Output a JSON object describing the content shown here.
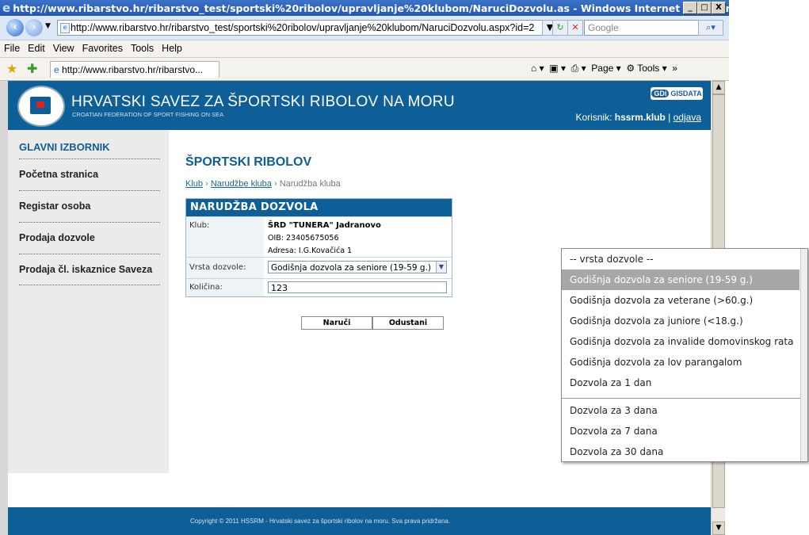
{
  "window": {
    "title": "http://www.ribarstvo.hr/ribarstvo_test/sportski%20ribolov/upravljanje%20klubom/NaruciDozvolu.as - Windows Internet Explorer",
    "controls": [
      "_",
      "□",
      "X"
    ]
  },
  "addressbar": {
    "url": "http://www.ribarstvo.hr/ribarstvo_test/sportski%20ribolov/upravljanje%20klubom/NaruciDozvolu.aspx?id=2",
    "search_placeholder": "Google"
  },
  "menu": [
    "File",
    "Edit",
    "View",
    "Favorites",
    "Tools",
    "Help"
  ],
  "favbar": {
    "tab": "http://www.ribarstvo.hr/ribarstvo...",
    "tools": [
      "Page",
      "Tools"
    ]
  },
  "header": {
    "title": "HRVATSKI SAVEZ ZA ŠPORTSKI RIBOLOV NA MORU",
    "subtitle": "CROATIAN FEDERATION OF SPORT FISHING ON SEA",
    "partner_logo_a": "GDi",
    "partner_logo_b": "GISDATA",
    "user_label": "Korisnik:",
    "user_name": "hssrm.klub",
    "logout": "odjava"
  },
  "sidebar": {
    "title": "GLAVNI IZBORNIK",
    "items": [
      {
        "label": "Početna stranica"
      },
      {
        "label": "Registar osoba"
      },
      {
        "label": "Prodaja dozvole"
      },
      {
        "label": "Prodaja čl. iskaznice Saveza"
      }
    ]
  },
  "main": {
    "title": "ŠPORTSKI RIBOLOV",
    "breadcrumb": [
      "Klub",
      "Narudžbe kluba",
      "Narudžba kluba"
    ],
    "breadcrumb_sep": "›"
  },
  "form": {
    "heading": "NARUDŽBA DOZVOLA",
    "klub_label": "Klub:",
    "klub_name": "ŠRD \"TUNERA\" Jadranovo",
    "oib": "OIB: 23405675056",
    "adresa": "Adresa: I.G.Kovačića 1",
    "vrsta_label": "Vrsta dozvole:",
    "vrsta_value": "Godišnja dozvola za seniore (19-59 g.)",
    "kolicina_label": "Količina:",
    "kolicina_value": "123",
    "order_button": "Naruči",
    "cancel_button": "Odustani"
  },
  "dropdown": {
    "options": [
      "-- vrsta dozvole --",
      "Godišnja dozvola za seniore (19-59 g.)",
      "Godišnja dozvola za veterane (>60.g.)",
      "Godišnja dozvola za juniore (<18.g.)",
      "Godišnja dozvola za invalide domovinskog rata",
      "Godišnja dozvola za lov parangalom",
      "Dozvola za 1 dan"
    ],
    "options_more": [
      "Dozvola za 3 dana",
      "Dozvola za 7 dana",
      "Dozvola za 30 dana"
    ],
    "selected_index": 1
  },
  "footer": {
    "text": "Copyright © 2011 HSSRM - Hrvatski savez za športski ribolov na moru. Sva prava pridržana."
  },
  "colors": {
    "brand": "#0e5f97",
    "sidebar_bg": "#ecebe9",
    "highlight": "#a7a7a7"
  }
}
